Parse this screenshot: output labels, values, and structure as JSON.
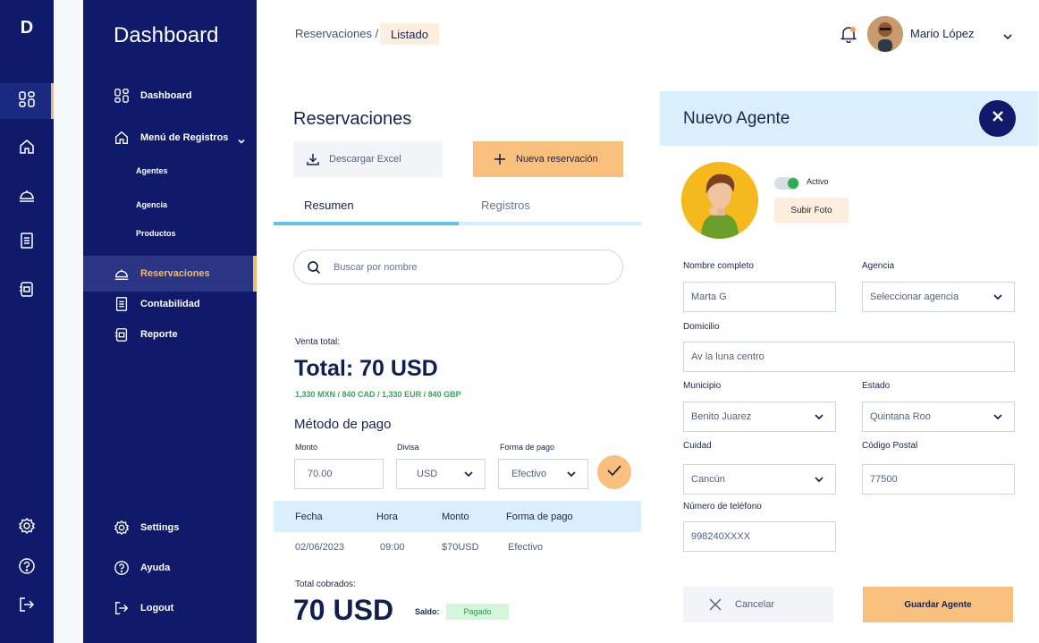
{
  "rail": {
    "logo": "D",
    "icons": [
      "grid-icon",
      "home-icon",
      "service-bell-icon",
      "document-icon",
      "report-icon",
      "settings-icon",
      "help-icon",
      "logout-icon"
    ]
  },
  "sidebar": {
    "brand": "Dashboard",
    "items": [
      {
        "label": "Dashboard",
        "icon": "grid-icon"
      },
      {
        "label": "Menú de Registros",
        "icon": "home-icon"
      },
      {
        "label": "Reservaciones",
        "icon": "service-bell-icon"
      },
      {
        "label": "Contabilidad",
        "icon": "document-icon"
      },
      {
        "label": "Reporte",
        "icon": "report-icon"
      },
      {
        "label": "Settings",
        "icon": "settings-icon"
      },
      {
        "label": "Ayuda",
        "icon": "help-icon"
      },
      {
        "label": "Logout",
        "icon": "logout-icon"
      }
    ],
    "subitems": [
      "Agentes",
      "Agencia",
      "Productos"
    ],
    "active": "Reservaciones"
  },
  "header": {
    "breadcrumb_root": "Reservaciones /",
    "breadcrumb_current": "Listado",
    "user_name": "Mario López"
  },
  "main": {
    "title": "Reservaciones",
    "download_label": "Descargar Excel",
    "new_label": "Nueva reservación",
    "tabs": [
      {
        "label": "Resumen",
        "active": true
      },
      {
        "label": "Registros",
        "active": false
      }
    ],
    "search_placeholder": "Buscar por nombre",
    "venta_label": "Venta total:",
    "venta_total": "Total: 70 USD",
    "conversions": "1,330 MXN / 840 CAD / 1,330 EUR / 840 GBP",
    "payment_title": "Método de pago",
    "monto_label": "Monto",
    "monto_value": "70.00",
    "divisa_label": "Divisa",
    "divisa_value": "USD",
    "forma_label": "Forma de pago",
    "forma_value": "Efectivo",
    "table": {
      "headers": [
        "Fecha",
        "Hora",
        "Monto",
        "Forma de pago"
      ],
      "rows": [
        [
          "02/06/2023",
          "09:00",
          "$70USD",
          "Efectivo"
        ]
      ]
    },
    "cobrados_label": "Total cobrados:",
    "cobrados_value": "70 USD",
    "saldo_label": "Saldo:",
    "saldo_status": "Pagado"
  },
  "panel": {
    "title": "Nuevo Agente",
    "status_label": "Activo",
    "status_on": true,
    "upload_label": "Subir Foto",
    "fields": {
      "nombre": {
        "label": "Nombre completo",
        "value": "Marta G"
      },
      "agencia": {
        "label": "Agencia",
        "value": "Seleccionar agencia"
      },
      "domicilio": {
        "label": "Domicilio",
        "value": "Av la luna centro"
      },
      "municipio": {
        "label": "Municipio",
        "value": "Benito Juarez"
      },
      "estado": {
        "label": "Estado",
        "value": "Quintana Roo"
      },
      "ciudad": {
        "label": "Cuidad",
        "value": "Cancún"
      },
      "cp": {
        "label": "Código Postal",
        "value": "77500"
      },
      "telefono": {
        "label": "Número de teléfono",
        "value": "998240XXXX"
      }
    },
    "cancel_label": "Cancelar",
    "save_label": "Guardar Agente"
  },
  "colors": {
    "navy": "#0f1a6b",
    "accent": "#f8c07c",
    "light_blue": "#d9f0fc",
    "tab_active": "#5fc3ec",
    "success": "#29b04a"
  }
}
